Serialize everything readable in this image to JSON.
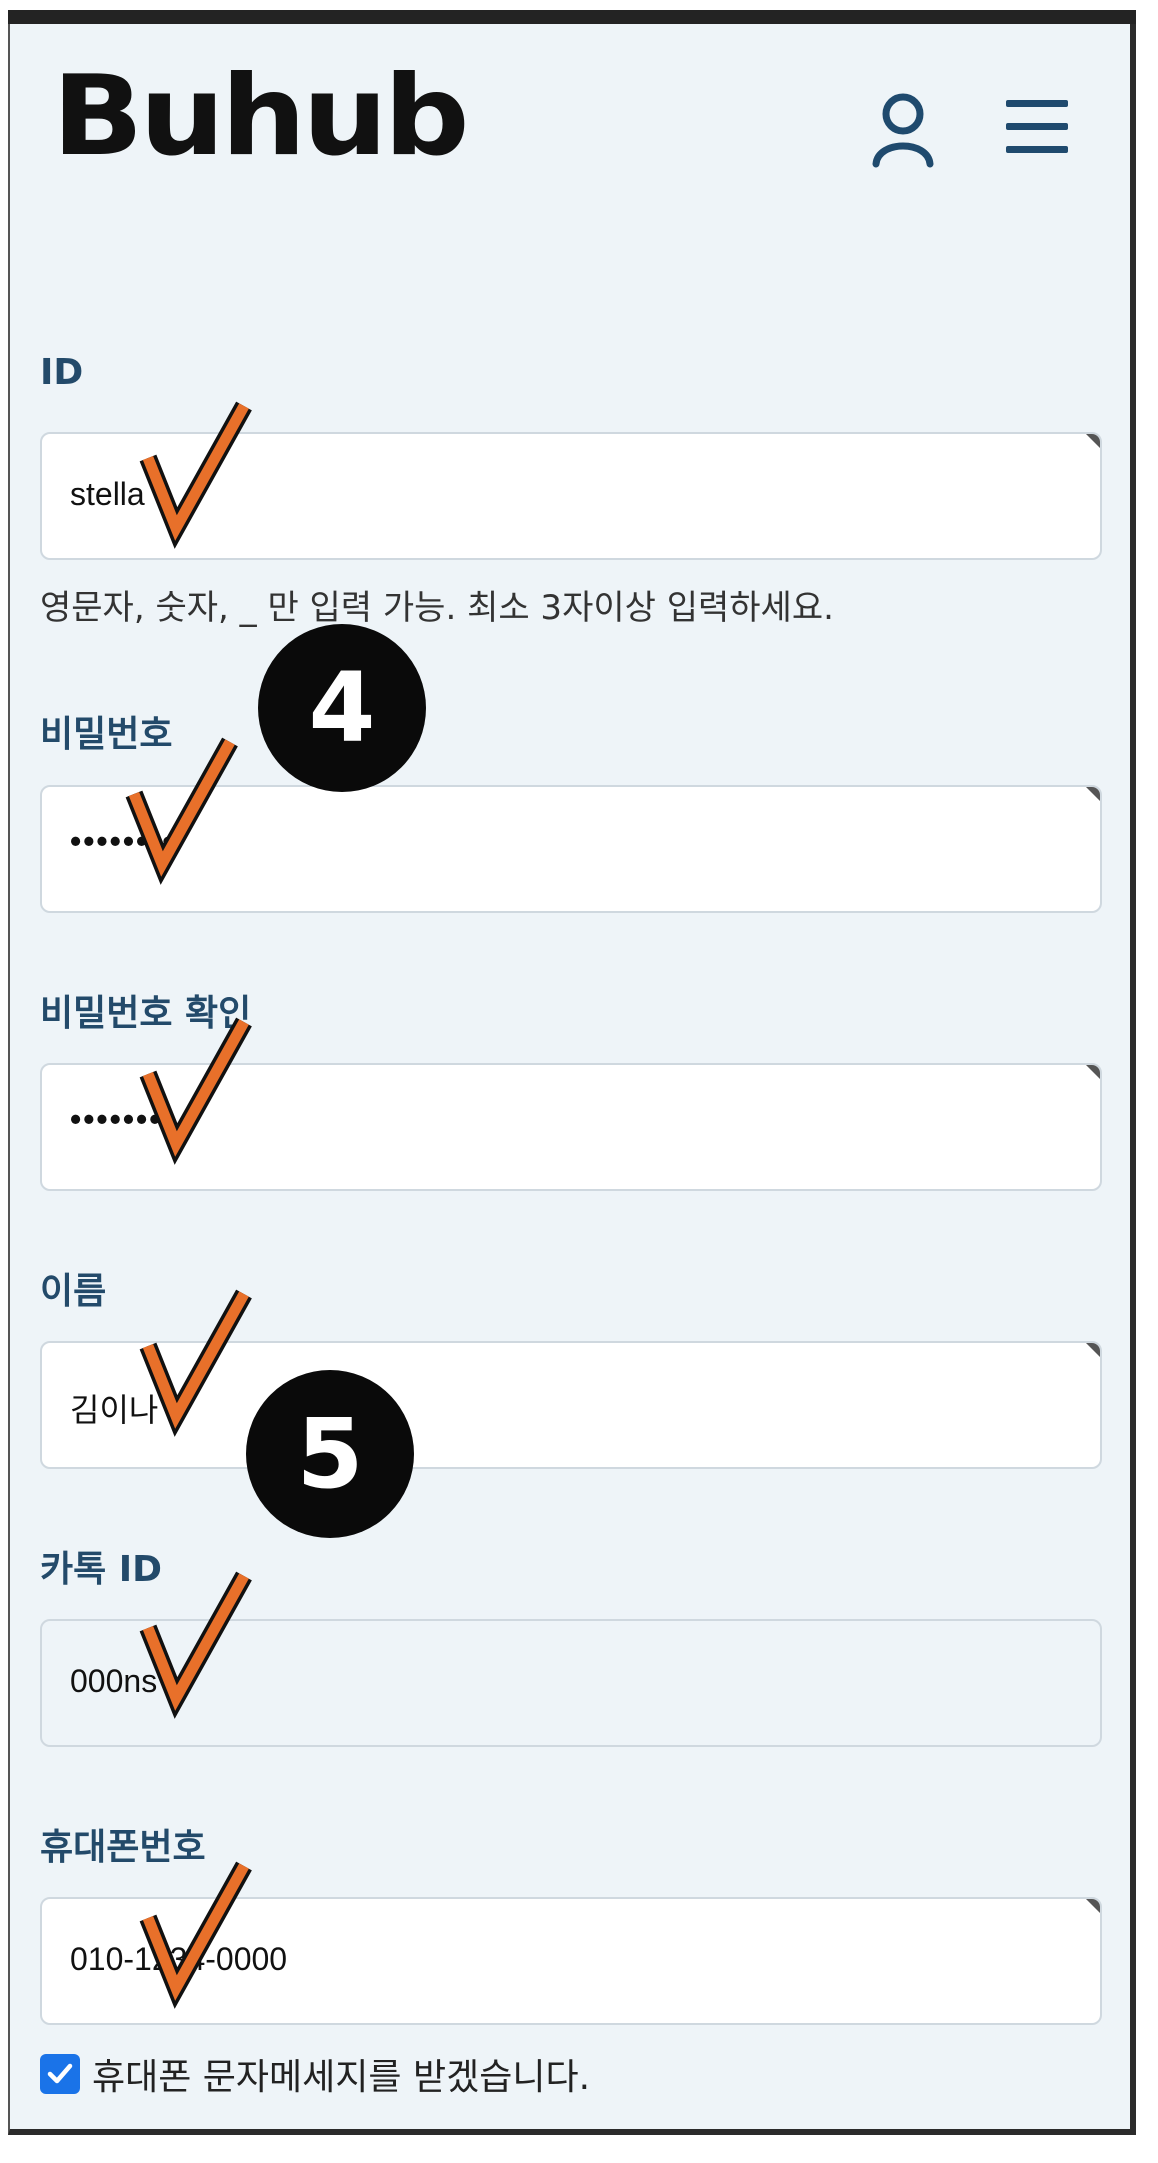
{
  "header": {
    "logo": "Buhub",
    "icons": [
      "user-icon",
      "menu-icon"
    ]
  },
  "form": {
    "id": {
      "label": "ID",
      "value": "stella",
      "helper": "영문자, 숫자, _ 만 입력 가능. 최소 3자이상 입력하세요."
    },
    "password": {
      "label": "비밀번호",
      "value": "••••••••"
    },
    "password_confirm": {
      "label": "비밀번호 확인",
      "value": "••••••••"
    },
    "name": {
      "label": "이름",
      "value": "김이나"
    },
    "kakao_id": {
      "label": "카톡 ID",
      "value": "000ns"
    },
    "phone": {
      "label": "휴대폰번호",
      "value": "010-1234-0000"
    },
    "sms_consent": {
      "label": "휴대폰 문자메세지를 받겠습니다.",
      "checked": true
    }
  },
  "annotations": {
    "step_badge_1": "4",
    "step_badge_2": "5",
    "checkmark_color": "#e8702a"
  },
  "colors": {
    "label": "#234a6a",
    "background": "#eef4f8",
    "checkbox": "#1a73e8"
  }
}
